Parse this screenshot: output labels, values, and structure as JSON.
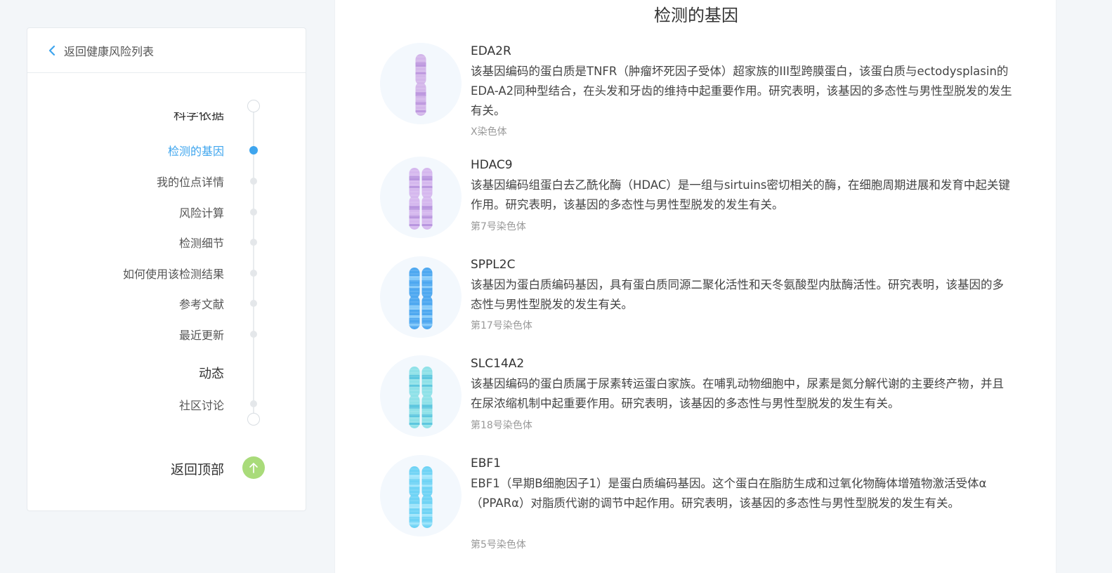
{
  "sidebar": {
    "back_label": "返回健康风险列表",
    "partial_top_label": "科学依据",
    "items": [
      {
        "label": "检测的基因",
        "active": true
      },
      {
        "label": "我的位点详情",
        "active": false
      },
      {
        "label": "风险计算",
        "active": false
      },
      {
        "label": "检测细节",
        "active": false
      },
      {
        "label": "如何使用该检测结果",
        "active": false
      },
      {
        "label": "参考文献",
        "active": false
      },
      {
        "label": "最近更新",
        "active": false
      }
    ],
    "section_heading": "动态",
    "partial_bottom_label": "社区讨论",
    "back_to_top_label": "返回顶部"
  },
  "main": {
    "title": "检测的基因",
    "genes": [
      {
        "name": "EDA2R",
        "description": "该基因编码的蛋白质是TNFR（肿瘤坏死因子受体）超家族的III型跨膜蛋白，该蛋白质与ectodysplasin的EDA-A2同种型结合，在头发和牙齿的维持中起重要作用。研究表明，该基因的多态性与男性型脱发的发生有关。",
        "chromosome": "X染色体",
        "chromosome_type": "single",
        "color": "#d3b6ea",
        "band_color": "#b893dd"
      },
      {
        "name": "HDAC9",
        "description": "该基因编码组蛋白去乙酰化酶（HDAC）是一组与sirtuins密切相关的酶，在细胞周期进展和发育中起关键作用。研究表明，该基因的多态性与男性型脱发的发生有关。",
        "chromosome": "第7号染色体",
        "chromosome_type": "pair",
        "color": "#d5b8ee",
        "band_color": "#b48fdc"
      },
      {
        "name": "SPPL2C",
        "description": "该基因为蛋白质编码基因，具有蛋白质同源二聚化活性和天冬氨酸型内肽酶活性。研究表明，该基因的多态性与男性型脱发的发生有关。",
        "chromosome": "第17号染色体",
        "chromosome_type": "pair",
        "color": "#4ea8f0",
        "band_color": "#8fd0fb"
      },
      {
        "name": "SLC14A2",
        "description": "该基因编码的蛋白质属于尿素转运蛋白家族。在哺乳动物细胞中，尿素是氮分解代谢的主要终产物，并且在尿浓缩机制中起重要作用。研究表明，该基因的多态性与男性型脱发的发生有关。",
        "chromosome": "第18号染色体",
        "chromosome_type": "pair",
        "color": "#8fe1e8",
        "band_color": "#55c2dd"
      },
      {
        "name": "EBF1",
        "description": "EBF1（早期B细胞因子1）是蛋白质编码基因。这个蛋白在脂肪生成和过氧化物酶体增殖物激活受体α（PPARα）对脂质代谢的调节中起作用。研究表明，该基因的多态性与男性型脱发的发生有关。",
        "chromosome": "第5号染色体",
        "chromosome_type": "pair",
        "color": "#6fd3f5",
        "band_color": "#a8e8fb"
      }
    ]
  }
}
